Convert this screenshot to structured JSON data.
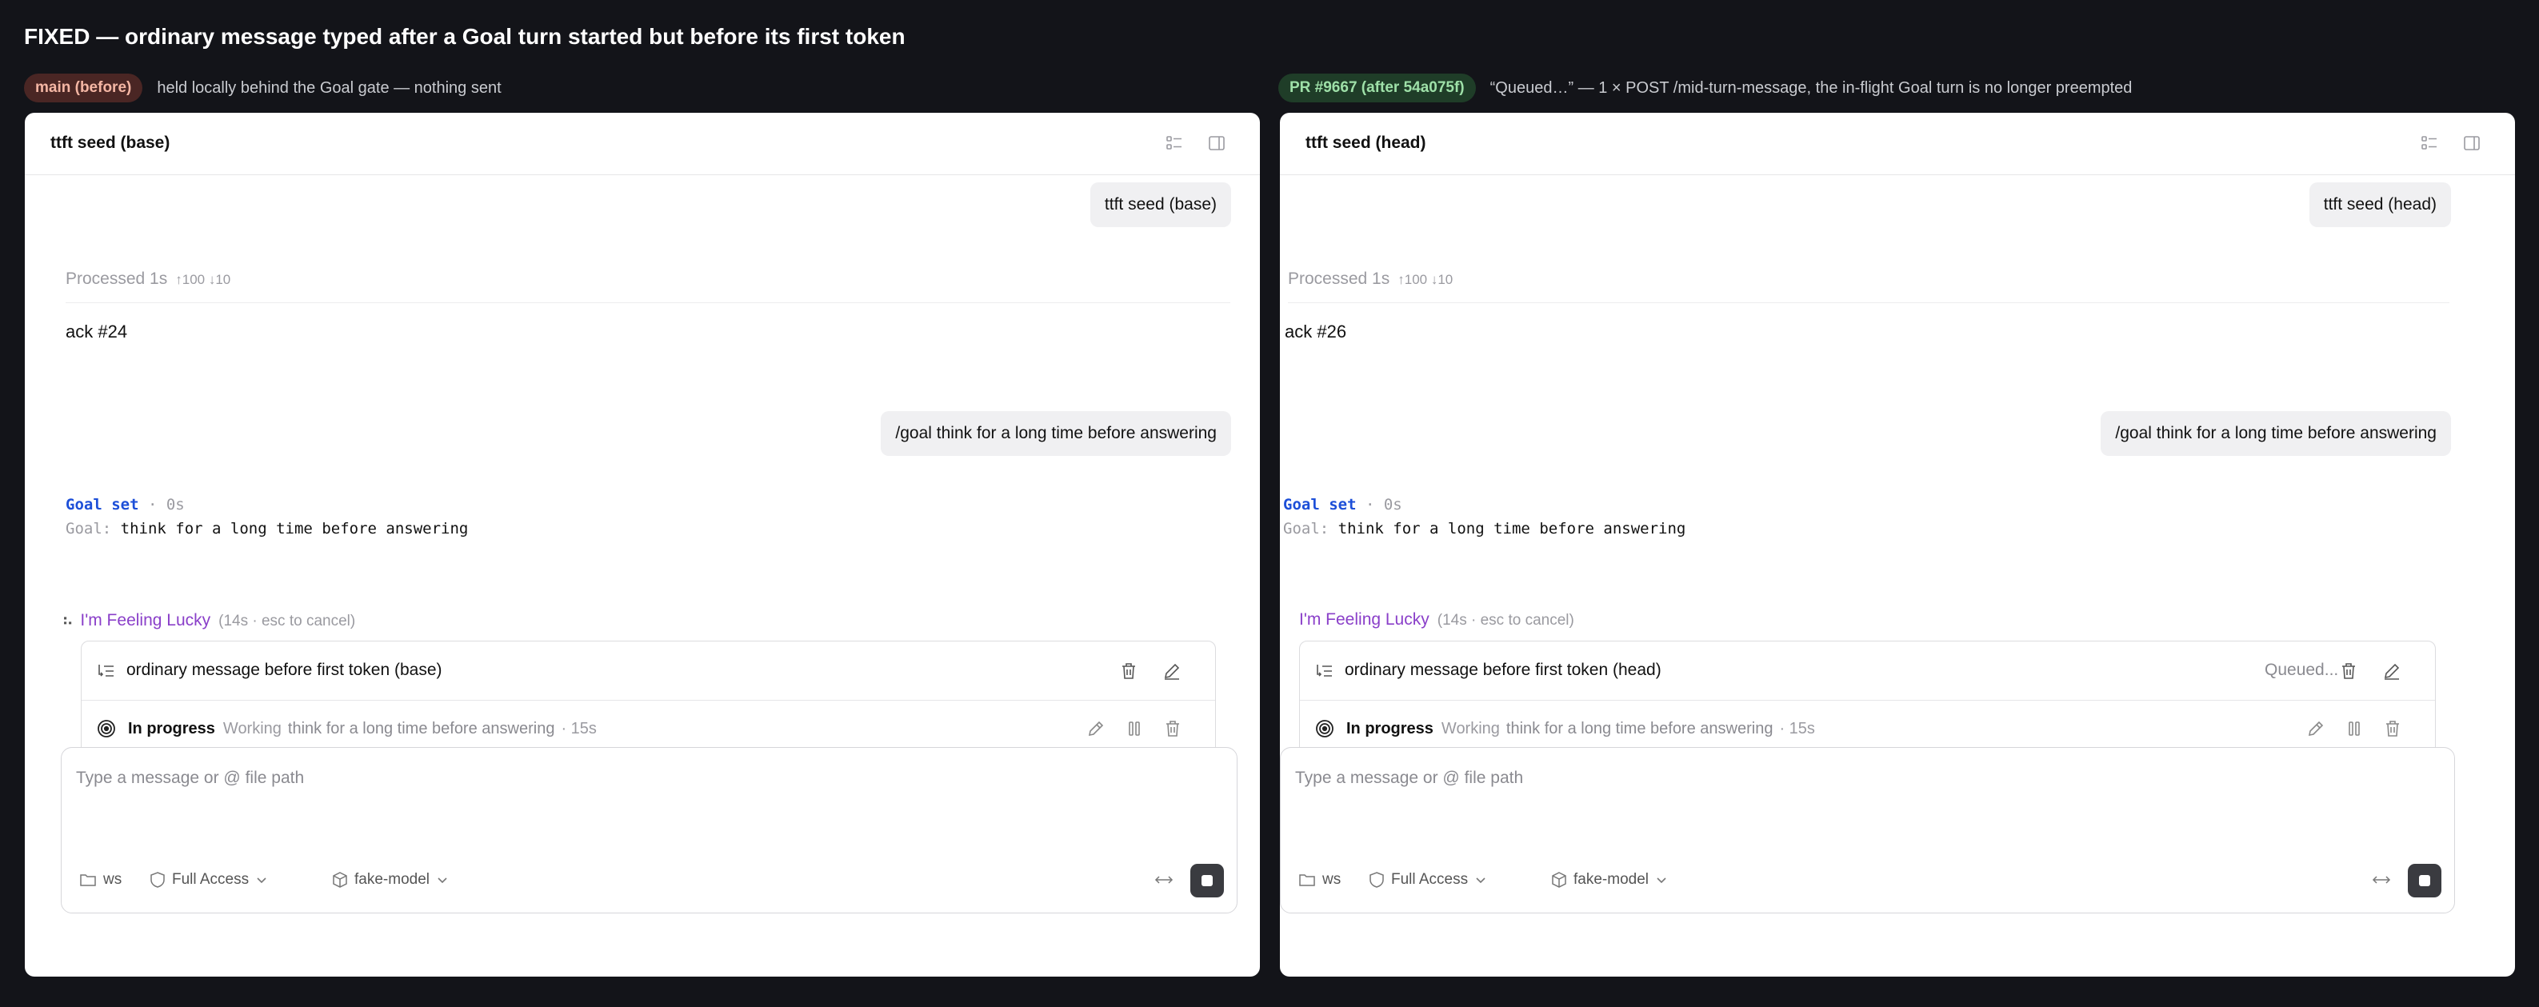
{
  "title": "FIXED — ordinary message typed after a Goal turn started but before its first token",
  "left": {
    "badge": "main (before)",
    "caption": "held locally behind the Goal gate — nothing sent",
    "panel_title": "ttft seed (base)",
    "seed_bubble": "ttft seed (base)",
    "processed": "Processed 1s",
    "tokens": "↑100 ↓10",
    "ack": "ack #24",
    "goal_bubble": "/goal think for a long time before answering",
    "goal_set": "Goal set",
    "goal_set_meta": "· 0s",
    "goal_key": "Goal:",
    "goal_value": "think for a long time before answering",
    "lucky_label": "I'm Feeling Lucky",
    "lucky_hint": "(14s · esc to cancel)",
    "queued_message": "ordinary message before first token (base)",
    "queued_status": "",
    "progress_label": "In progress",
    "progress_working": "Working",
    "progress_goal": "think for a long time before answering",
    "progress_time": "· 15s",
    "composer_placeholder": "Type a message or @ file path",
    "folder": "ws",
    "access": "Full Access",
    "model": "fake-model"
  },
  "right": {
    "badge": "PR #9667 (after 54a075f)",
    "caption": "“Queued…” — 1 × POST /mid-turn-message, the in-flight Goal turn is no longer preempted",
    "panel_title": "ttft seed (head)",
    "seed_bubble": "ttft seed (head)",
    "processed": "Processed 1s",
    "tokens": "↑100 ↓10",
    "ack": "ack #26",
    "goal_bubble": "/goal think for a long time before answering",
    "goal_set": "Goal set",
    "goal_set_meta": "· 0s",
    "goal_key": "Goal:",
    "goal_value": "think for a long time before answering",
    "lucky_label": "I'm Feeling Lucky",
    "lucky_hint": "(14s · esc to cancel)",
    "queued_message": "ordinary message before first token (head)",
    "queued_status": "Queued...",
    "progress_label": "In progress",
    "progress_working": "Working",
    "progress_goal": "think for a long time before answering",
    "progress_time": "· 15s",
    "composer_placeholder": "Type a message or @ file path",
    "folder": "ws",
    "access": "Full Access",
    "model": "fake-model"
  },
  "colors": {
    "background": "#131419",
    "goal_accent": "#1d4fd8",
    "lucky_accent": "#8a3fc9",
    "before_badge": "#4a2624",
    "after_badge": "#1f3d28"
  },
  "icons": [
    "list-icon",
    "sidebar-toggle-icon",
    "queue-icon",
    "trash-icon",
    "edit-icon",
    "target-icon",
    "pencil-icon",
    "pause-icon",
    "folder-icon",
    "shield-icon",
    "cube-icon",
    "chevron-down-icon",
    "expand-icon",
    "stop-icon"
  ]
}
